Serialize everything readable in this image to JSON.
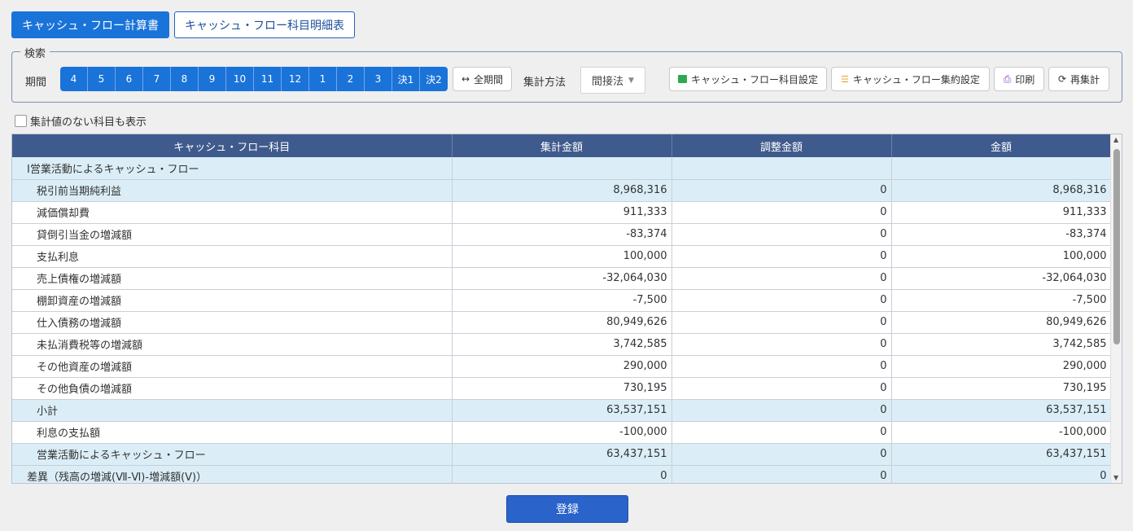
{
  "tabs": {
    "statement": "キャッシュ・フロー計算書",
    "detail": "キャッシュ・フロー科目明細表"
  },
  "search": {
    "legend": "検索",
    "period_label": "期間",
    "periods": [
      "4",
      "5",
      "6",
      "7",
      "8",
      "9",
      "10",
      "11",
      "12",
      "1",
      "2",
      "3",
      "決1",
      "決2"
    ],
    "all_period": "全期間",
    "method_label": "集計方法",
    "method_value": "間接法",
    "cf_item_setting": "キャッシュ・フロー科目設定",
    "cf_summary_setting": "キャッシュ・フロー集約設定",
    "print": "印刷",
    "recalc": "再集計"
  },
  "show_zero_label": "集計値のない科目も表示",
  "table": {
    "headers": [
      "キャッシュ・フロー科目",
      "集計金額",
      "調整金額",
      "金額"
    ],
    "rows": [
      {
        "item": "Ⅰ営業活動によるキャッシュ・フロー",
        "agg": "",
        "adj": "",
        "amt": "",
        "hl": true,
        "indent": 0
      },
      {
        "item": "税引前当期純利益",
        "agg": "8,968,316",
        "adj": "0",
        "amt": "8,968,316",
        "hl": true,
        "indent": 1
      },
      {
        "item": "減価償却費",
        "agg": "911,333",
        "adj": "0",
        "amt": "911,333",
        "hl": false,
        "indent": 1
      },
      {
        "item": "貸倒引当金の増減額",
        "agg": "-83,374",
        "adj": "0",
        "amt": "-83,374",
        "hl": false,
        "indent": 1
      },
      {
        "item": "支払利息",
        "agg": "100,000",
        "adj": "0",
        "amt": "100,000",
        "hl": false,
        "indent": 1
      },
      {
        "item": "売上債権の増減額",
        "agg": "-32,064,030",
        "adj": "0",
        "amt": "-32,064,030",
        "hl": false,
        "indent": 1
      },
      {
        "item": "棚卸資産の増減額",
        "agg": "-7,500",
        "adj": "0",
        "amt": "-7,500",
        "hl": false,
        "indent": 1
      },
      {
        "item": "仕入債務の増減額",
        "agg": "80,949,626",
        "adj": "0",
        "amt": "80,949,626",
        "hl": false,
        "indent": 1
      },
      {
        "item": "未払消費税等の増減額",
        "agg": "3,742,585",
        "adj": "0",
        "amt": "3,742,585",
        "hl": false,
        "indent": 1
      },
      {
        "item": "その他資産の増減額",
        "agg": "290,000",
        "adj": "0",
        "amt": "290,000",
        "hl": false,
        "indent": 1
      },
      {
        "item": "その他負債の増減額",
        "agg": "730,195",
        "adj": "0",
        "amt": "730,195",
        "hl": false,
        "indent": 1
      },
      {
        "item": "小計",
        "agg": "63,537,151",
        "adj": "0",
        "amt": "63,537,151",
        "hl": true,
        "indent": 1
      },
      {
        "item": "利息の支払額",
        "agg": "-100,000",
        "adj": "0",
        "amt": "-100,000",
        "hl": false,
        "indent": 1
      },
      {
        "item": "営業活動によるキャッシュ・フロー",
        "agg": "63,437,151",
        "adj": "0",
        "amt": "63,437,151",
        "hl": true,
        "indent": 1
      },
      {
        "item": "差異（残高の増減(Ⅶ-Ⅵ)-増減額(Ⅴ)）",
        "agg": "0",
        "adj": "0",
        "amt": "0",
        "hl": true,
        "indent": 0
      }
    ]
  },
  "register_label": "登録"
}
